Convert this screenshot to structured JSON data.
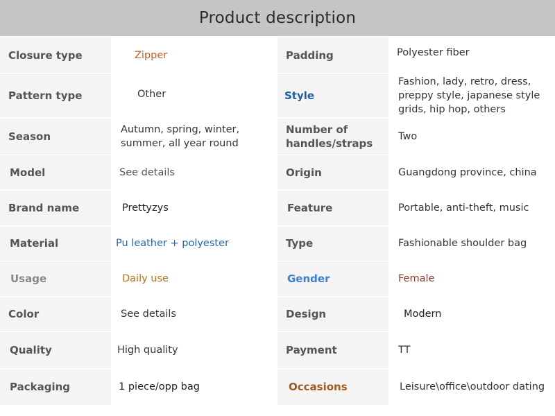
{
  "title": "Product description",
  "rows": [
    {
      "l1": "Closure type",
      "v1": "Zipper",
      "l2": "Padding",
      "v2": "Polyester fiber"
    },
    {
      "l1": "Pattern type",
      "v1": "Other",
      "l2": "Style",
      "v2": "Fashion, lady, retro, dress, preppy style, japanese style grids, hip hop, others"
    },
    {
      "l1": "Season",
      "v1": "Autumn, spring, winter, summer, all year round",
      "l2": "Number of handles/straps",
      "v2": "Two"
    },
    {
      "l1": "Model",
      "v1": "See details",
      "l2": "Origin",
      "v2": "Guangdong province, china"
    },
    {
      "l1": "Brand name",
      "v1": "Prettyzys",
      "l2": "Feature",
      "v2": "Portable, anti-theft, music"
    },
    {
      "l1": "Material",
      "v1": "Pu leather + polyester",
      "l2": "Type",
      "v2": "Fashionable shoulder bag"
    },
    {
      "l1": "Usage",
      "v1": "Daily use",
      "l2": "Gender",
      "v2": "Female"
    },
    {
      "l1": "Color",
      "v1": "See details",
      "l2": "Design",
      "v2": "Modern"
    },
    {
      "l1": "Quality",
      "v1": "High quality",
      "l2": "Payment",
      "v2": "TT"
    },
    {
      "l1": "Packaging",
      "v1": "1 piece/opp bag",
      "l2": "Occasions",
      "v2": "Leisure\\office\\outdoor dating"
    }
  ]
}
